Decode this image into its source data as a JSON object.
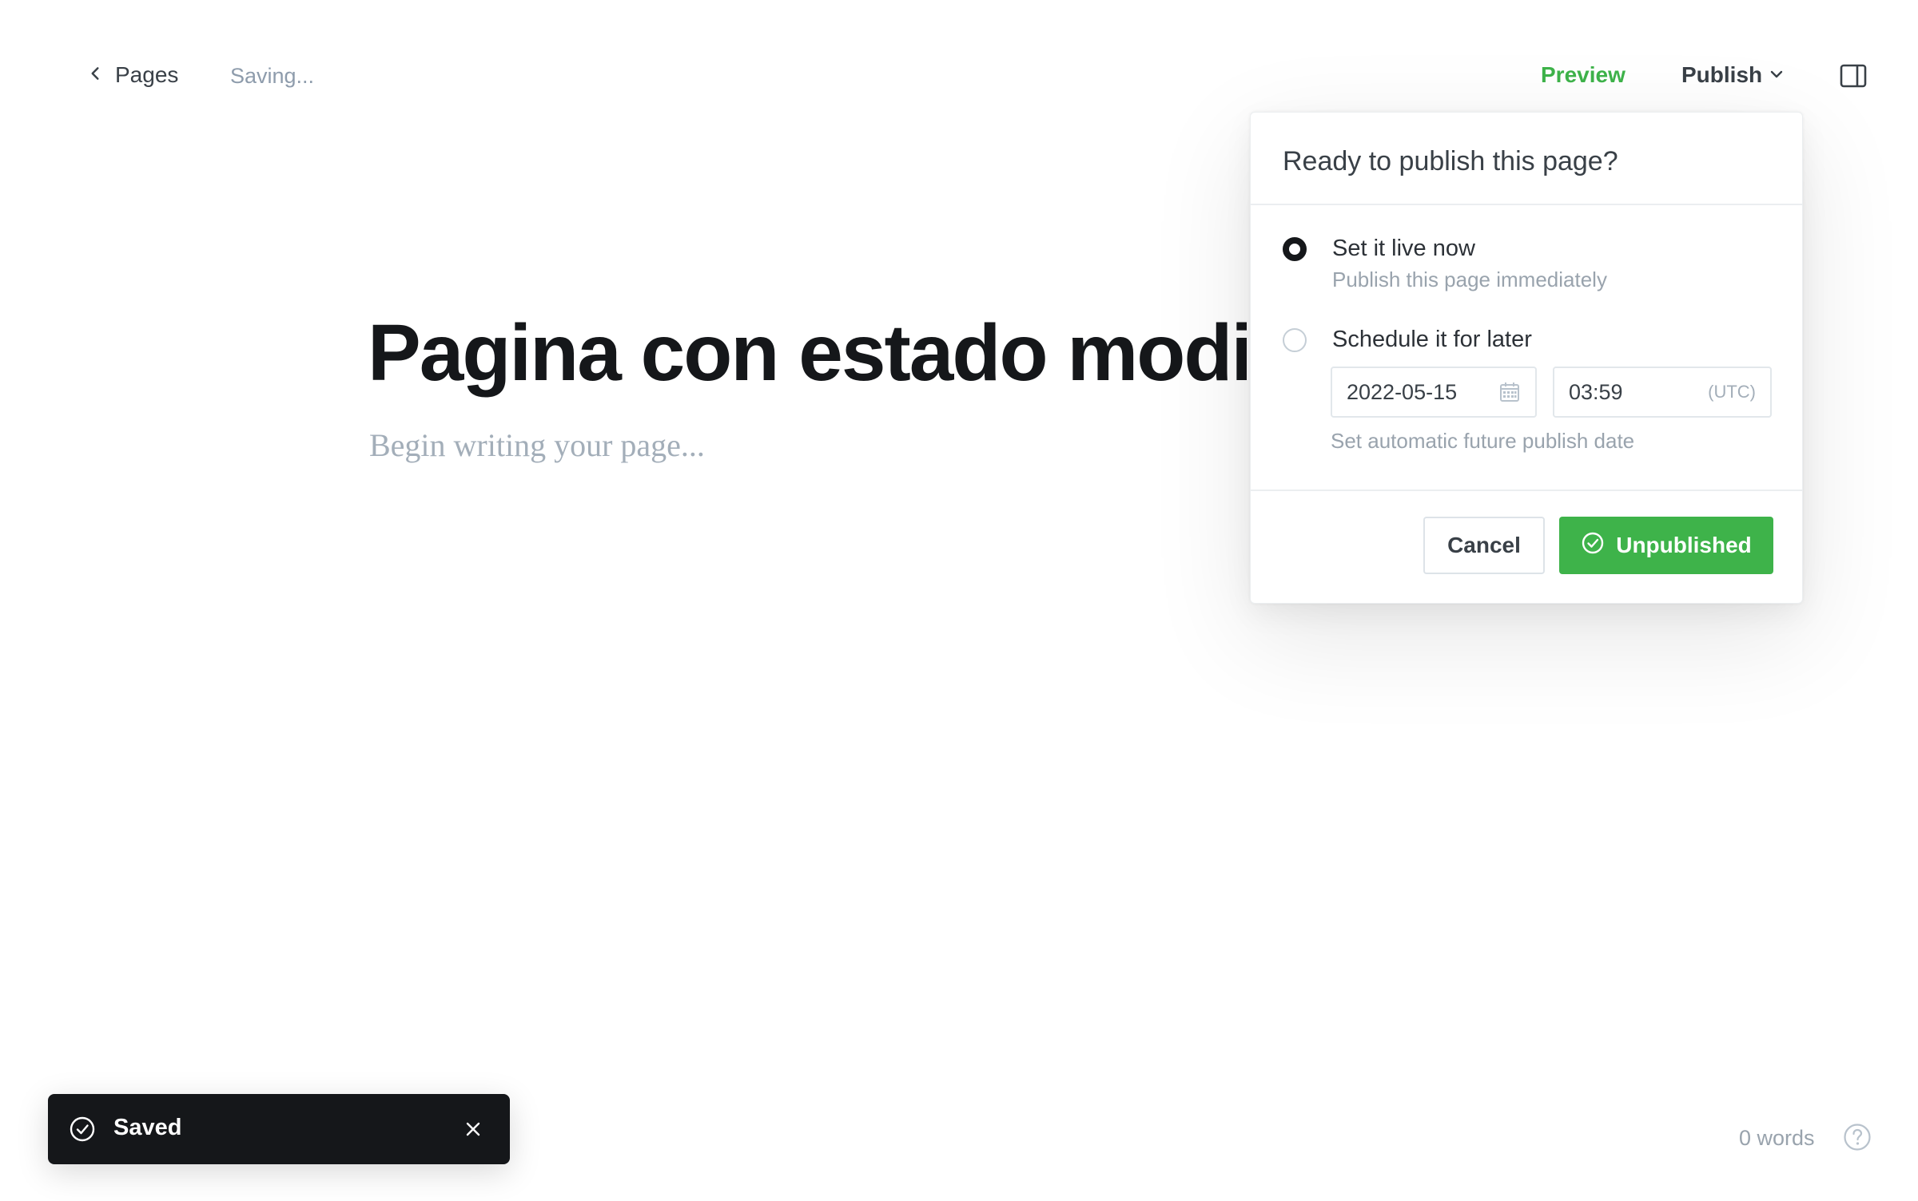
{
  "header": {
    "back_label": "Pages",
    "save_status": "Saving...",
    "preview_label": "Preview",
    "publish_label": "Publish"
  },
  "editor": {
    "title": "Pagina con estado modificado",
    "body_placeholder": "Begin writing your page..."
  },
  "publish_popover": {
    "title": "Ready to publish this page?",
    "options": [
      {
        "label": "Set it live now",
        "description": "Publish this page immediately",
        "selected": true
      },
      {
        "label": "Schedule it for later",
        "description": "",
        "selected": false
      }
    ],
    "date_value": "2022-05-15",
    "time_value": "03:59",
    "timezone": "(UTC)",
    "schedule_hint": "Set automatic future publish date",
    "cancel_label": "Cancel",
    "confirm_label": "Unpublished"
  },
  "toast": {
    "message": "Saved",
    "icon": "check-circle-icon"
  },
  "footer": {
    "word_count": "0 words",
    "help_icon": "help-icon"
  },
  "colors": {
    "accent_green": "#3eb34a",
    "text_dark": "#15171a",
    "text_muted": "#99a3ad",
    "toast_bg": "#15171a"
  }
}
